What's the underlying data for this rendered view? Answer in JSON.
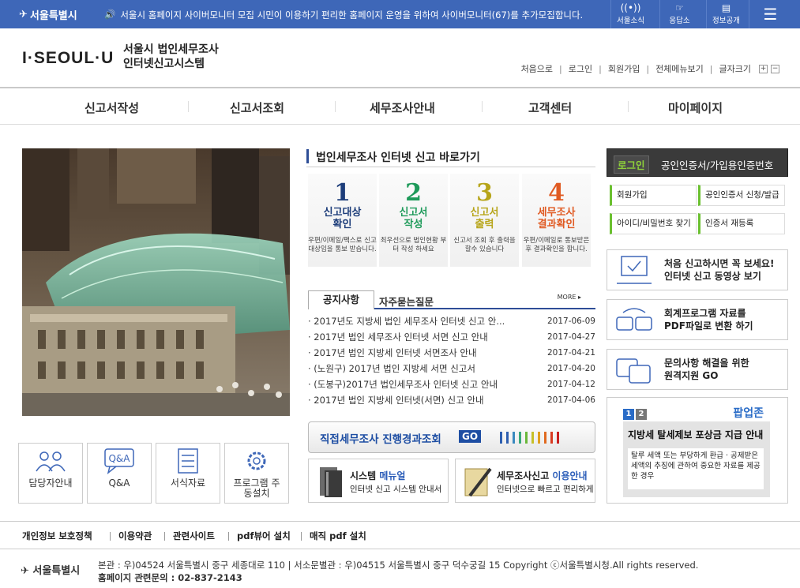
{
  "topbar": {
    "logo": "서울특별시",
    "notice": "서울시 홈페이지 사이버모니터 모집 시민이 이용하기 편리한 홈페이지 운영을 위하여 사이버모니터(67)를 추가모집합니다.",
    "util": [
      "서울소식",
      "응답소",
      "정보공개"
    ]
  },
  "header": {
    "brand": "I·SEOUL·U",
    "title_line1": "서울시 법인세무조사",
    "title_line2": "인터넷신고시스템",
    "links": [
      "처음으로",
      "로그인",
      "회원가입",
      "전체메뉴보기",
      "글자크기"
    ],
    "font_plus": "+",
    "font_minus": "−"
  },
  "gnb": [
    "신고서작성",
    "신고서조회",
    "세무조사안내",
    "고객센터",
    "마이페이지"
  ],
  "quick": [
    "담당자안내",
    "Q&A",
    "서식자료",
    "프로그램 주동설치"
  ],
  "shortcut": {
    "title": "법인세무조사 인터넷 신고 바로가기",
    "steps": [
      {
        "n": "1",
        "h1": "신고대상",
        "h2": "확인",
        "d": "우편/이메일/팩스로 신고대상임을 통보 받습니다.",
        "color": "#1d3d7a"
      },
      {
        "n": "2",
        "h1": "신고서",
        "h2": "작성",
        "d": "최우선으로 법인현황 부터 작성 하세요",
        "color": "#1e9a5a"
      },
      {
        "n": "3",
        "h1": "신고서",
        "h2": "출력",
        "d": "신고서 조회 후 출력을 할수 있습니다",
        "color": "#b7a51a"
      },
      {
        "n": "4",
        "h1": "세무조사",
        "h2": "결과확인",
        "d": "우편/이메일로 통보받은 후 결과확인을 합니다.",
        "color": "#e05a22"
      }
    ]
  },
  "board": {
    "tab_notice": "공지사항",
    "tab_faq": "자주묻는질문",
    "more": "MORE ▸",
    "items": [
      {
        "title": "· 2017년도 지방세 법인 세무조사 인터넷 신고 안...",
        "date": "2017-06-09"
      },
      {
        "title": "· 2017년 법인 세무조사 인터넷 서면 신고 안내",
        "date": "2017-04-27"
      },
      {
        "title": "· 2017년 법인 지방세 인터넷 서면조사 안내",
        "date": "2017-04-21"
      },
      {
        "title": "· (노원구) 2017년 법인 지방세 서면 신고서",
        "date": "2017-04-20"
      },
      {
        "title": "· (도봉구)2017년 법인세무조사 인터넷 신고 안내",
        "date": "2017-04-12"
      },
      {
        "title": "· 2017년 법인 지방세 인터넷(서면) 신고 안내",
        "date": "2017-04-06"
      }
    ]
  },
  "progress_button": {
    "label": "직접세무조사 진행경과조회",
    "go": "GO"
  },
  "sub": [
    {
      "t1a": "시스템 ",
      "t1b": "메뉴얼",
      "t2": "인터넷 신고 시스템 안내서"
    },
    {
      "t1a": "세무조사신고 ",
      "t1b": "이용안내",
      "t2": "인터넷으로 빠르고 편리하게"
    }
  ],
  "login": {
    "btn": "로그인",
    "cert": "공인인증서/가입용인증번호",
    "links": [
      "회원가입",
      "공인인증서 신청/발급",
      "아이디/비밀번호 찾기",
      "인증서 재등록"
    ]
  },
  "services": [
    {
      "l1": "처음 신고하시면 꼭 보세요!",
      "l2": "인터넷 신고 동영상 보기"
    },
    {
      "l1": "회계프로그램 자료를",
      "l2": "PDF파일로 변환 하기"
    },
    {
      "l1": "문의사항 해결을 위한",
      "l2": "원격지원 GO"
    }
  ],
  "popup": {
    "pages": [
      "1",
      "2"
    ],
    "zone": "팝업존",
    "headline": "지방세 탈세제보 포상금 지급 안내",
    "body": "탈루 세액 또는 부당하게 환급 · 공제받은 세액의 추징에 관하여 중요한 자료를 제공한 경우"
  },
  "footer_nav": [
    "개인정보 보호정책",
    "이용약관",
    "관련사이트",
    "pdf뷰어 설치",
    "매직 pdf 설치"
  ],
  "footer": {
    "logo": "서울특별시",
    "address": "본관 : 우)04524 서울특별시 중구 세종대로 110 | 서소문별관 : 우)04515 서울특별시 중구 덕수궁길 15 Copyright ⓒ서울특별시청.All rights reserved.",
    "contact": "홈페이지 관련문의 : 02-837-2143"
  },
  "colors": {
    "topbar": "#3e67b8",
    "accent": "#2e4e97",
    "login_green": "#8fd13a"
  }
}
